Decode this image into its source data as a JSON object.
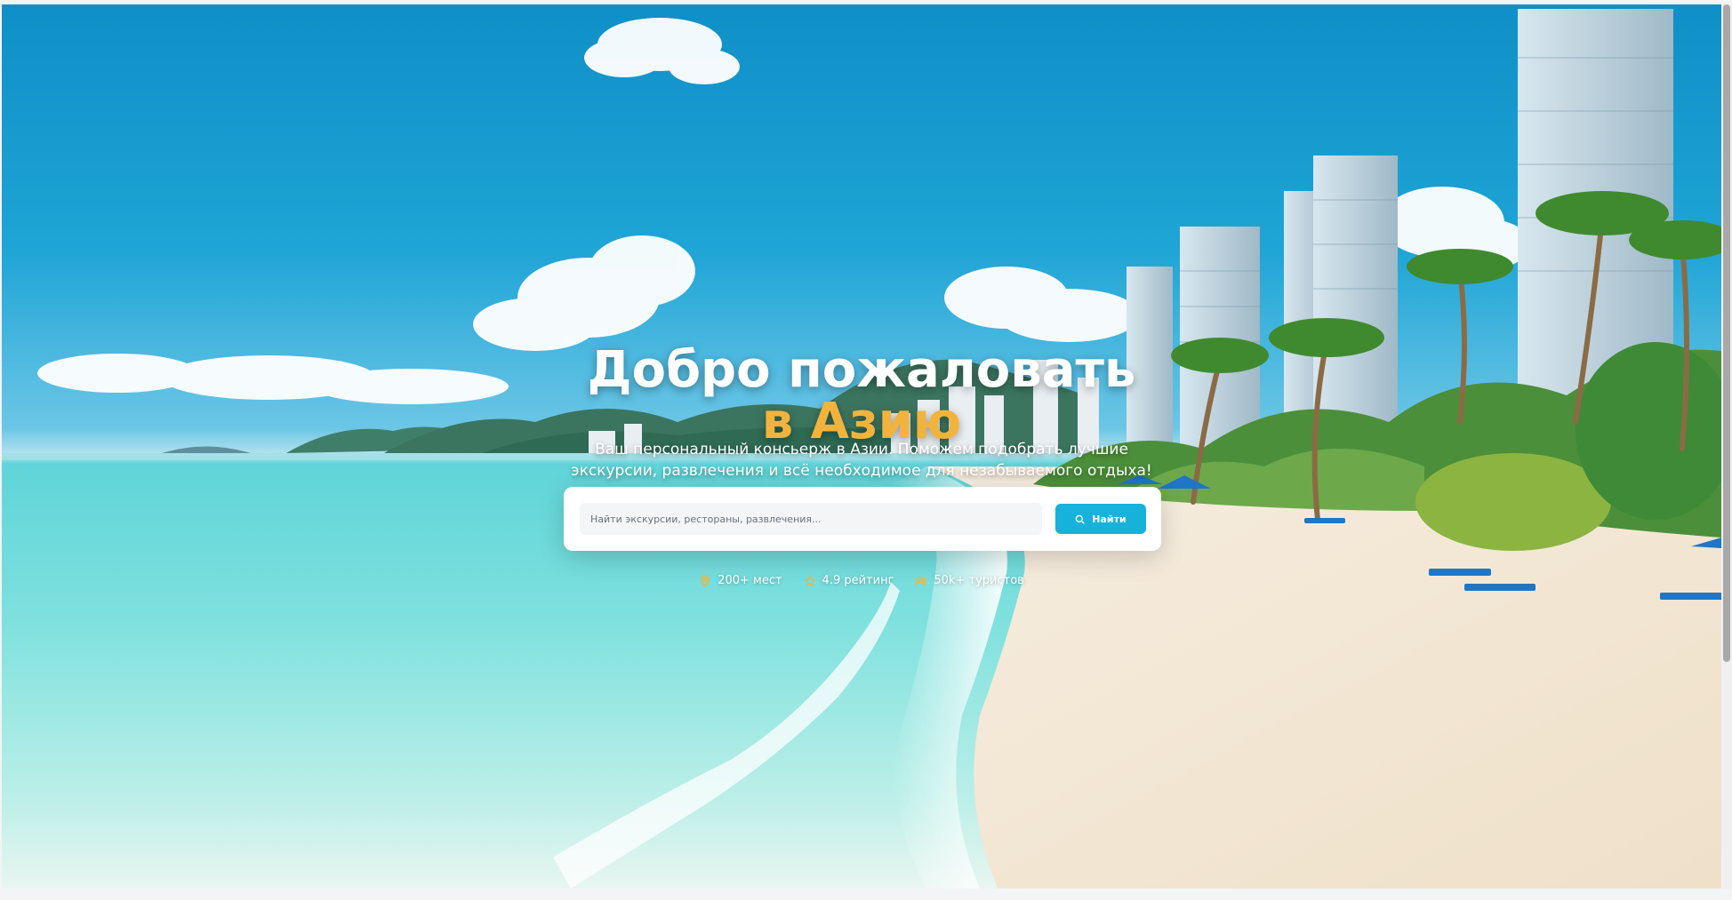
{
  "hero": {
    "title_line1": "Добро пожаловать",
    "title_line2": "в Азию",
    "subtitle": "Ваш персональный консьерж в Азии. Поможем подобрать лучшие экскурсии, развлечения и всё необходимое для незабываемого отдыха!"
  },
  "search": {
    "placeholder": "Найти экскурсии, рестораны, развлечения...",
    "button_label": "Найти",
    "button_icon": "search-icon"
  },
  "stats": [
    {
      "icon": "map-pin-icon",
      "label": "200+ мест"
    },
    {
      "icon": "star-icon",
      "label": "4.9 рейтинг"
    },
    {
      "icon": "users-icon",
      "label": "50k+ туристов"
    }
  ],
  "colors": {
    "accent": "#f2b33d",
    "button": "#16b2dc",
    "stat_icon": "#f2b33d"
  }
}
